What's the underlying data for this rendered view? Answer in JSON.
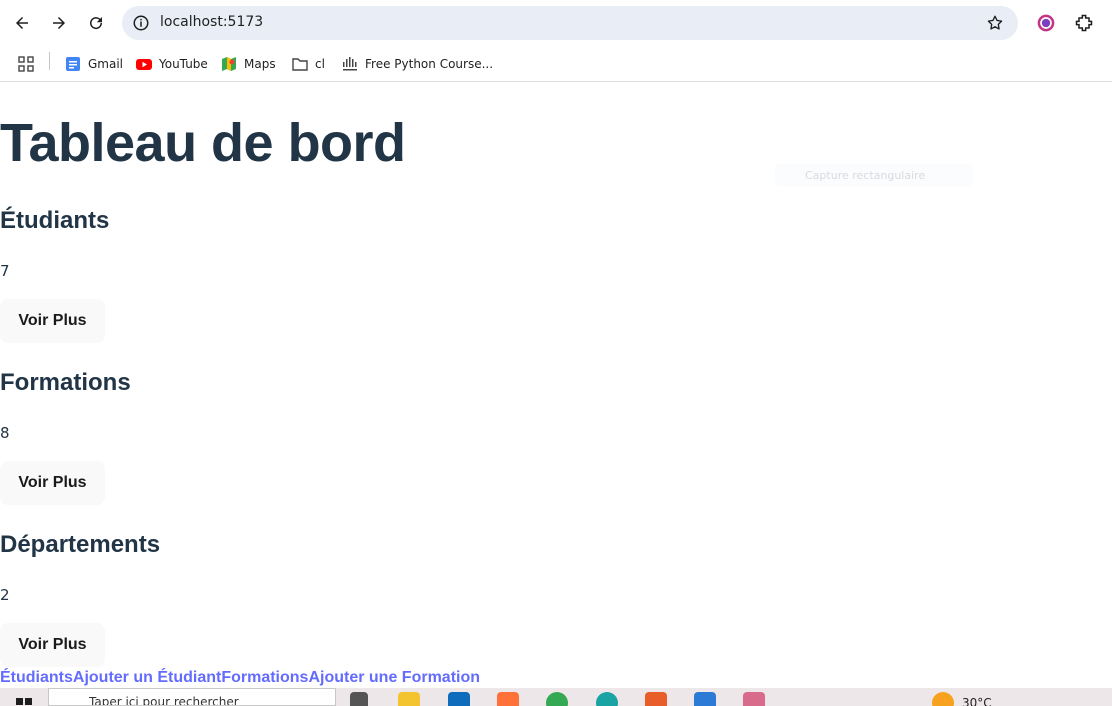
{
  "browser": {
    "url": "localhost:5173",
    "bookmarks": [
      {
        "label": "Gmail",
        "icon": "gmail-icon"
      },
      {
        "label": "YouTube",
        "icon": "youtube-icon"
      },
      {
        "label": "Maps",
        "icon": "maps-icon"
      },
      {
        "label": "cl",
        "icon": "folder-icon"
      },
      {
        "label": "Free Python Course...",
        "icon": "cisco-icon"
      }
    ]
  },
  "page": {
    "title": "Tableau de bord",
    "sections": [
      {
        "heading": "Étudiants",
        "value": "7",
        "button": "Voir Plus"
      },
      {
        "heading": "Formations",
        "value": "8",
        "button": "Voir Plus"
      },
      {
        "heading": "Départements",
        "value": "2",
        "button": "Voir Plus"
      }
    ],
    "links": [
      "Étudiants",
      "Ajouter un Étudiant",
      "Formations",
      "Ajouter une Formation"
    ]
  },
  "overlay": {
    "capture_label": "Capture rectangulaire"
  },
  "taskbar": {
    "search_placeholder": "Taper ici pour rechercher",
    "temperature": "30°C"
  },
  "colors": {
    "heading": "#213547",
    "link": "#646cff",
    "button_bg": "#f9f9f9",
    "omnibox_bg": "#e9eef6"
  }
}
